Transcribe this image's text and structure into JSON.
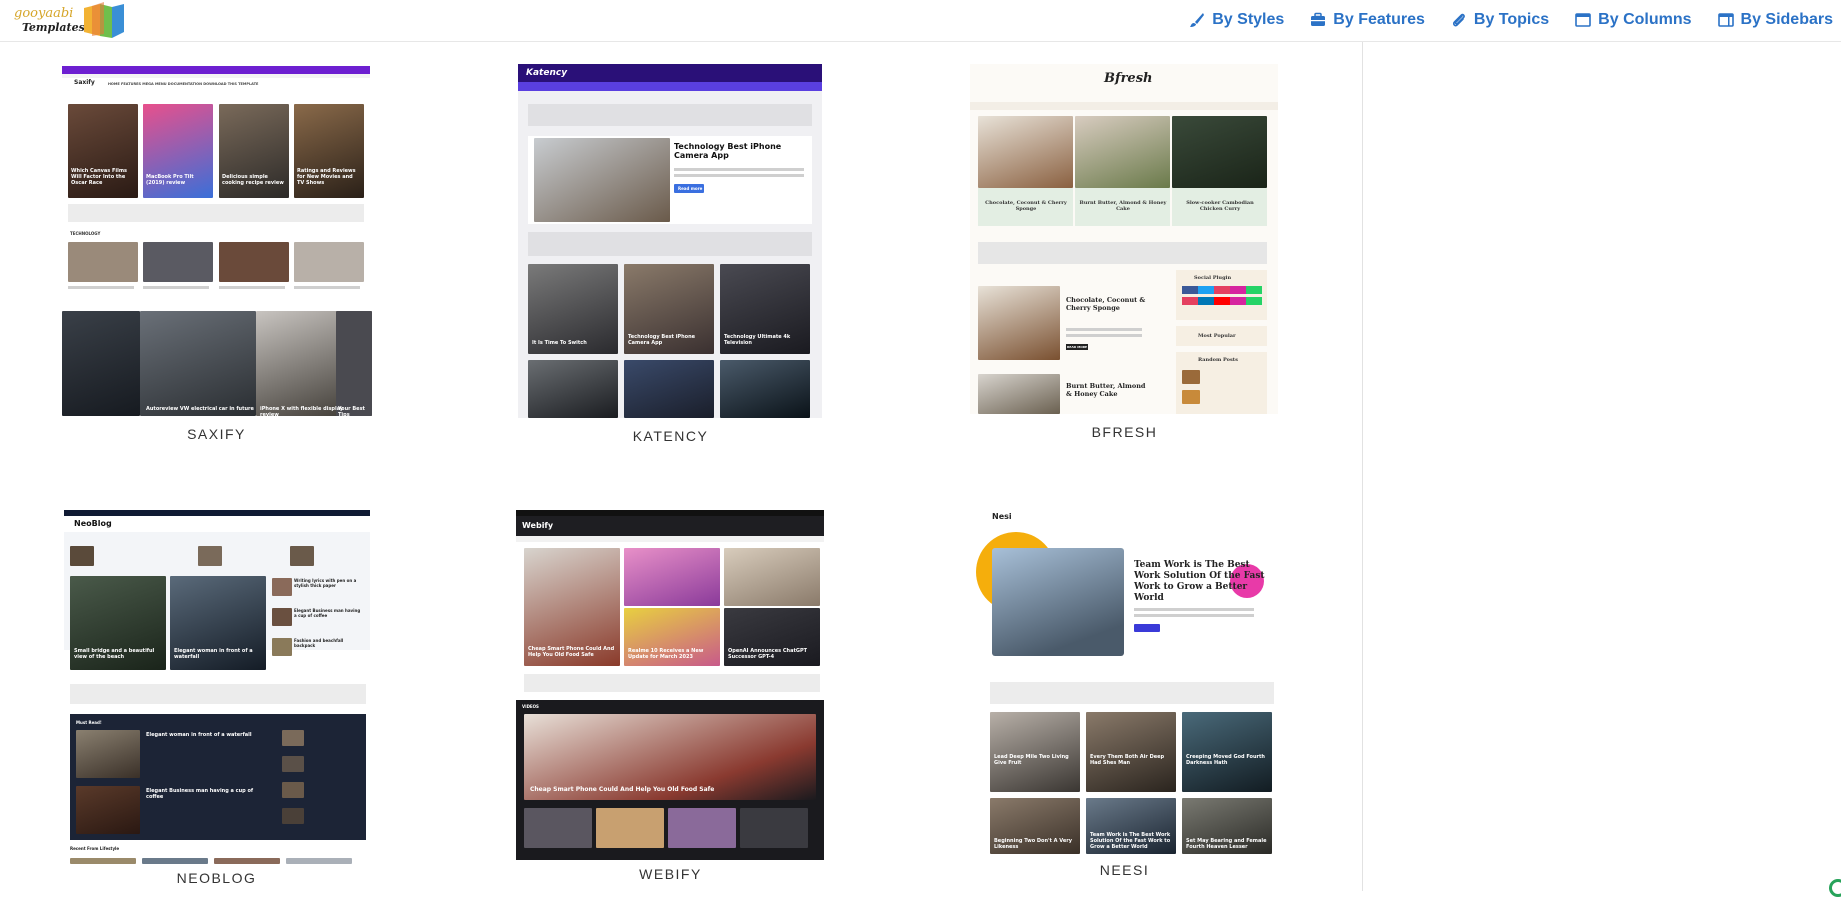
{
  "nav": {
    "items": [
      {
        "label": "By Styles",
        "icon": "brush-icon"
      },
      {
        "label": "By Features",
        "icon": "briefcase-icon"
      },
      {
        "label": "By Topics",
        "icon": "paperclip-icon"
      },
      {
        "label": "By Columns",
        "icon": "columns-window-icon"
      },
      {
        "label": "By Sidebars",
        "icon": "sidebar-window-icon"
      }
    ],
    "color": "#2b72c6"
  },
  "logo": {
    "top": "gooyaabi",
    "bottom": "Templates"
  },
  "templates": [
    {
      "name": "SAXIFY"
    },
    {
      "name": "KATENCY"
    },
    {
      "name": "BFRESH"
    },
    {
      "name": "NEOBLOG"
    },
    {
      "name": "WEBIFY"
    },
    {
      "name": "NEESI"
    }
  ],
  "previews": {
    "saxify": {
      "brand": "Saxify",
      "nav": "HOME   FEATURES   MEGA MENU   DOCUMENTATION   DOWNLOAD THIS TEMPLATE",
      "posts": [
        "Which Canvas Films Will Factor Into the Oscar Race",
        "MacBook Pro Tilt (2019) review",
        "Delicious simple cooking recipe review",
        "Ratings and Reviews for New Movies and TV Shows"
      ],
      "section": "TECHNOLOGY",
      "slider": [
        "Autoreview VW electrical car in future",
        "iPhone X with flexible display review",
        "Your Best Tips"
      ]
    },
    "katency": {
      "brand": "Katency",
      "headline": "Technology Best iPhone Camera App",
      "read_more": "Read more",
      "posts": [
        "It Is Time To Switch",
        "Technology Best iPhone Camera App",
        "Technology Ultimate 4k Television"
      ]
    },
    "bfresh": {
      "brand": "Bfresh",
      "posts": [
        "Chocolate, Coconut & Cherry Sponge",
        "Burnt Butter, Almond & Honey Cake",
        "Slow-cooker Cambodian Chicken Curry"
      ],
      "list": [
        "Chocolate, Coconut & Cherry Sponge",
        "Burnt Butter, Almond & Honey Cake"
      ],
      "widgets": [
        "Social Plugin",
        "Most Popular",
        "Random Posts"
      ],
      "read_more": "READ MORE"
    },
    "neoblog": {
      "brand": "NeoBlog",
      "posts": [
        "Small bridge and a beautiful view of the beach",
        "Elegant woman in front of a waterfall"
      ],
      "side": [
        "Writing lyrics with pen on a stylish thick paper",
        "Elegant Business man having a cup of coffee",
        "Fashion and beachfall backpack"
      ],
      "dark_title": "Must Read!",
      "dark_posts": [
        "Elegant woman in front of a waterfall",
        "Elegant Business man having a cup of coffee"
      ],
      "footer": "Recent From Lifestyle"
    },
    "webify": {
      "brand": "Webify",
      "posts": [
        "Cheap Smart Phone Could And Help You Old Food Safe",
        "Realme 10 Receives a New Update for March 2023",
        "OpenAI Announces ChatGPT Successor GPT-4"
      ],
      "video_title": "Cheap Smart Phone Could And Help You Old Food Safe",
      "section": "VIDEOS"
    },
    "neesi": {
      "brand": "Nesi",
      "headline": "Team Work is The Best Work Solution Of the Fast Work to Grow a Better World",
      "posts": [
        "Lead Deep Mile Two Living Give Fruit",
        "Every Them Both Air Deep Had Shes Man",
        "Creeping Moved God Fourth Darkness Hath",
        "Beginning Two Don't A Very Likeness",
        "Team Work is The Best Work Solution Of the Fast Work to Grow a Better World",
        "Set May Bearing and Female Fourth Heaven Lesser"
      ]
    }
  }
}
